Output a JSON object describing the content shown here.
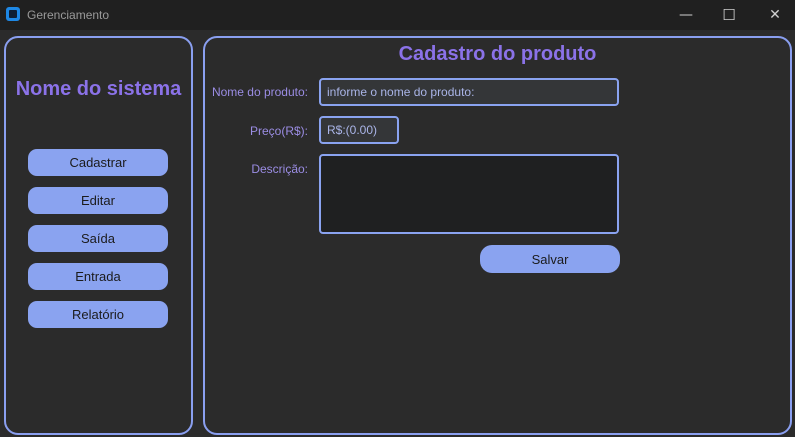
{
  "window": {
    "title": "Gerenciamento",
    "minimize_glyph": "—",
    "maximize_glyph": "☐",
    "close_glyph": "✕"
  },
  "sidebar": {
    "system_name": "Nome do sistema",
    "items": [
      {
        "label": "Cadastrar"
      },
      {
        "label": "Editar"
      },
      {
        "label": "Saída"
      },
      {
        "label": "Entrada"
      },
      {
        "label": "Relatório"
      }
    ]
  },
  "form": {
    "title": "Cadastro do produto",
    "name_label": "Nome do produto:",
    "name_value": "informe o nome do produto:",
    "price_label": "Preço(R$):",
    "price_value": "R$:(0.00)",
    "description_label": "Descrição:",
    "description_value": "",
    "save_label": "Salvar"
  },
  "colors": {
    "accent": "#8aa3f0",
    "title_text": "#8b72e8",
    "background": "#2b2b2b"
  }
}
